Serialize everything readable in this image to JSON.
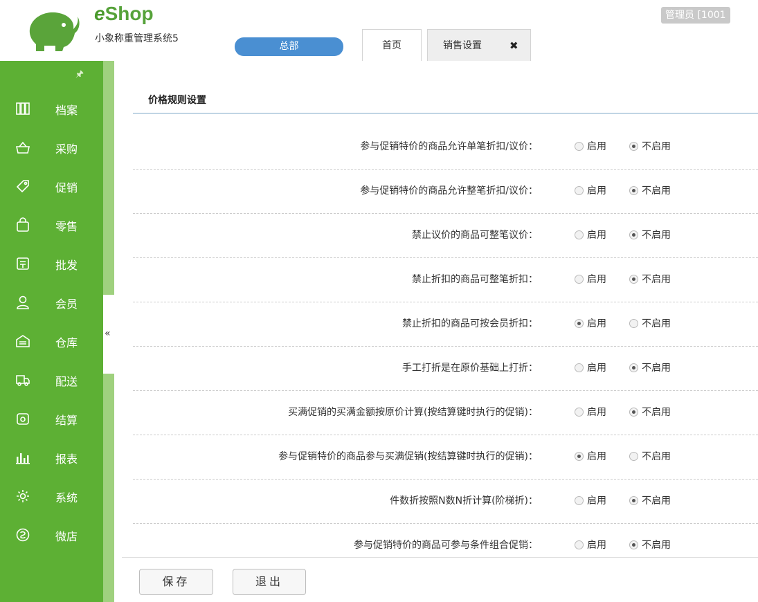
{
  "header": {
    "brand_e": "e",
    "brand_rest": "Shop",
    "subtitle": "小象称重管理系统5",
    "branch": "总部",
    "admin": "管理员 [1001",
    "tabs": [
      {
        "label": "首页"
      },
      {
        "label": "销售设置",
        "close": "✖"
      }
    ]
  },
  "sidebar": {
    "pin": "🖈",
    "collapse": "«",
    "items": [
      {
        "label": "档案",
        "icon": "archive-icon"
      },
      {
        "label": "采购",
        "icon": "basket-icon"
      },
      {
        "label": "促销",
        "icon": "tag-icon"
      },
      {
        "label": "零售",
        "icon": "bag-icon"
      },
      {
        "label": "批发",
        "icon": "ledger-icon"
      },
      {
        "label": "会员",
        "icon": "user-icon"
      },
      {
        "label": "仓库",
        "icon": "warehouse-icon"
      },
      {
        "label": "配送",
        "icon": "truck-icon"
      },
      {
        "label": "结算",
        "icon": "wallet-icon"
      },
      {
        "label": "报表",
        "icon": "bar-chart-icon"
      },
      {
        "label": "系统",
        "icon": "gear-icon"
      },
      {
        "label": "微店",
        "icon": "shop-icon"
      }
    ]
  },
  "main": {
    "title": "价格规则设置",
    "on_label": "启用",
    "off_label": "不启用",
    "rules": [
      {
        "question": "参与促销特价的商品允许单笔折扣/议价：",
        "enabled": false
      },
      {
        "question": "参与促销特价的商品允许整笔折扣/议价：",
        "enabled": false
      },
      {
        "question": "禁止议价的商品可整笔议价：",
        "enabled": false
      },
      {
        "question": "禁止折扣的商品可整笔折扣：",
        "enabled": false
      },
      {
        "question": "禁止折扣的商品可按会员折扣：",
        "enabled": true
      },
      {
        "question": "手工打折是在原价基础上打折：",
        "enabled": false
      },
      {
        "question": "买满促销的买满金额按原价计算(按结算键时执行的促销)：",
        "enabled": false
      },
      {
        "question": "参与促销特价的商品参与买满促销(按结算键时执行的促销)：",
        "enabled": true
      },
      {
        "question": "件数折按照N数N折计算(阶梯折)：",
        "enabled": false
      },
      {
        "question": "参与促销特价的商品可参与条件组合促销：",
        "enabled": false
      }
    ]
  },
  "footer": {
    "save": "保存",
    "exit": "退出"
  },
  "colors": {
    "sidebar": "#5db034",
    "branch": "#4a8fd2",
    "brand": "#4a9a2c"
  }
}
